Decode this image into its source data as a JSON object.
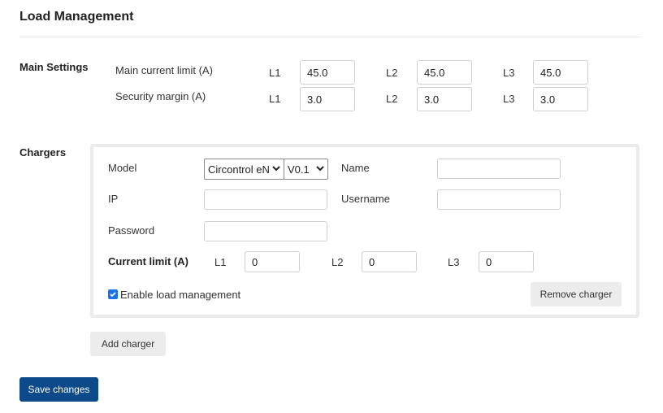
{
  "page": {
    "title": "Load Management"
  },
  "main_settings": {
    "section_label": "Main Settings",
    "main_current_limit": {
      "label": "Main current limit (A)",
      "l1_label": "L1",
      "l1": "45.0",
      "l2_label": "L2",
      "l2": "45.0",
      "l3_label": "L3",
      "l3": "45.0"
    },
    "security_margin": {
      "label": "Security margin (A)",
      "l1_label": "L1",
      "l1": "3.0",
      "l2_label": "L2",
      "l2": "3.0",
      "l3_label": "L3",
      "l3": "3.0"
    }
  },
  "chargers": {
    "section_label": "Chargers",
    "items": [
      {
        "model_label": "Model",
        "model_value": "Circontrol eNé",
        "version_value": "V0.1",
        "name_label": "Name",
        "name_value": "",
        "ip_label": "IP",
        "ip_value": "",
        "username_label": "Username",
        "username_value": "",
        "password_label": "Password",
        "password_value": "",
        "current_limit_label": "Current limit (A)",
        "l1_label": "L1",
        "l1": "0",
        "l2_label": "L2",
        "l2": "0",
        "l3_label": "L3",
        "l3": "0",
        "enable_label": "Enable load management",
        "enable_checked": true,
        "remove_label": "Remove charger"
      }
    ],
    "add_label": "Add charger"
  },
  "save_label": "Save changes",
  "colors": {
    "primary": "#0c4a8a",
    "checkbox": "#1a73e8",
    "button_grey": "#ececec"
  },
  "icons": {
    "select_arrow": "chevron-down-icon",
    "checkmark": "check-icon"
  }
}
